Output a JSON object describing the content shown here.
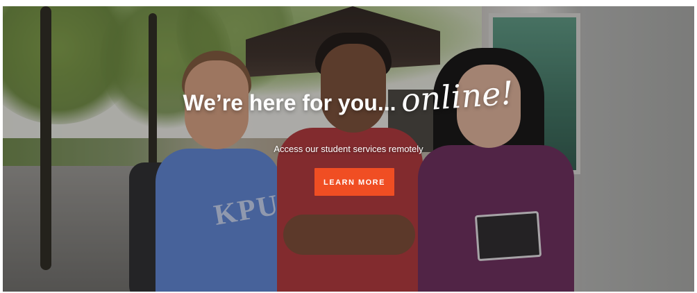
{
  "hero": {
    "headline": {
      "main": "We’re here for you...",
      "script": "online!"
    },
    "subtitle": "Access our student services remotely",
    "cta_label": "LEARN MORE",
    "shirt_text": "KPU",
    "colors": {
      "cta_background": "#f04e23",
      "text": "#ffffff"
    }
  }
}
